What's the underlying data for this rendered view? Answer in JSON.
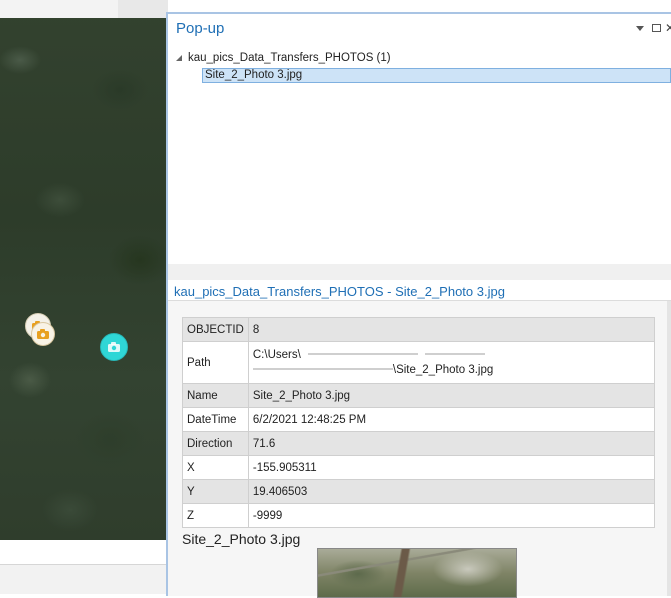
{
  "popup": {
    "title": "Pop-up",
    "tree": {
      "layer_label": "kau_pics_Data_Transfers_PHOTOS  (1)",
      "selected_feature": "Site_2_Photo 3.jpg"
    },
    "detail_title": "kau_pics_Data_Transfers_PHOTOS - Site_2_Photo 3.jpg",
    "attributes": [
      {
        "key": "OBJECTID",
        "value": "8"
      },
      {
        "key": "Path",
        "value": "C:\\Users\\",
        "value_line2": "\\Site_2_Photo 3.jpg"
      },
      {
        "key": "Name",
        "value": "Site_2_Photo 3.jpg"
      },
      {
        "key": "DateTime",
        "value": "6/2/2021 12:48:25 PM"
      },
      {
        "key": "Direction",
        "value": "71.6"
      },
      {
        "key": "X",
        "value": "-155.905311"
      },
      {
        "key": "Y",
        "value": "19.406503"
      },
      {
        "key": "Z",
        "value": "-9999"
      }
    ],
    "photo_caption": "Site_2_Photo 3.jpg"
  },
  "icons": {
    "pin": "pin-icon",
    "maximize": "maximize-icon",
    "close": "close-icon",
    "camera": "camera-icon"
  },
  "colors": {
    "title_blue": "#1f6fb5",
    "selected_row": "#cde3f7",
    "marker_cyan": "#2fd6d6",
    "marker_orange": "#e8a020"
  }
}
